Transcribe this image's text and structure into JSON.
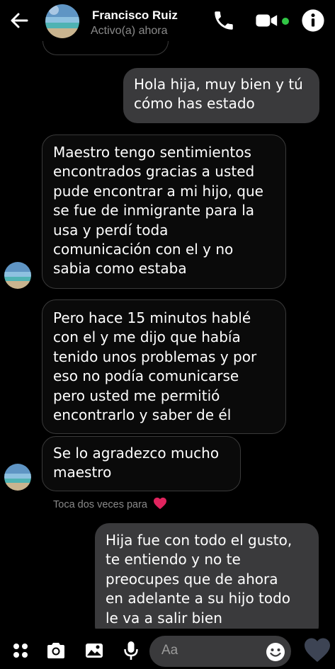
{
  "header": {
    "contact_name": "Francisco Ruiz",
    "status": "Activo(a) ahora",
    "icons": [
      "back-arrow-icon",
      "phone-icon",
      "video-camera-icon",
      "info-icon"
    ],
    "online_color": "#31c645"
  },
  "messages": [
    {
      "side": "out",
      "text": "Hola hija, muy bien y tú\ncómo has estado"
    },
    {
      "side": "in",
      "text": "Maestro tengo sentimientos\nencontrados gracias a usted\npude encontrar a mi hijo, que\nse fue de inmigrante para la\nusa y perdí  toda\ncomunicación con el y no\nsabia como estaba"
    },
    {
      "side": "in",
      "text": "Pero hace 15 minutos hablé\ncon el y me dijo que había\ntenido unos problemas y por\neso no podía comunicarse\npero usted me permitió\nencontrarlo y saber de él"
    },
    {
      "side": "in",
      "text": "Se lo agradezco mucho\nmaestro"
    },
    {
      "side": "out",
      "text": "Hija fue con todo el gusto,\nte entiendo y no te\npreocupes que de ahora\nen adelante a su hijo todo\nle va a salir bien"
    }
  ],
  "reaction_hint": "Toca dos veces para",
  "composer": {
    "placeholder": "Aa",
    "icons": [
      "menu-dots-icon",
      "camera-icon",
      "image-icon",
      "microphone-icon",
      "emoji-icon",
      "heart-like-icon"
    ]
  },
  "colors": {
    "background": "#000000",
    "incoming_bubble_border": "#3a3a3a",
    "outgoing_bubble": "#3a3a3c",
    "heart": "#e0245e"
  }
}
